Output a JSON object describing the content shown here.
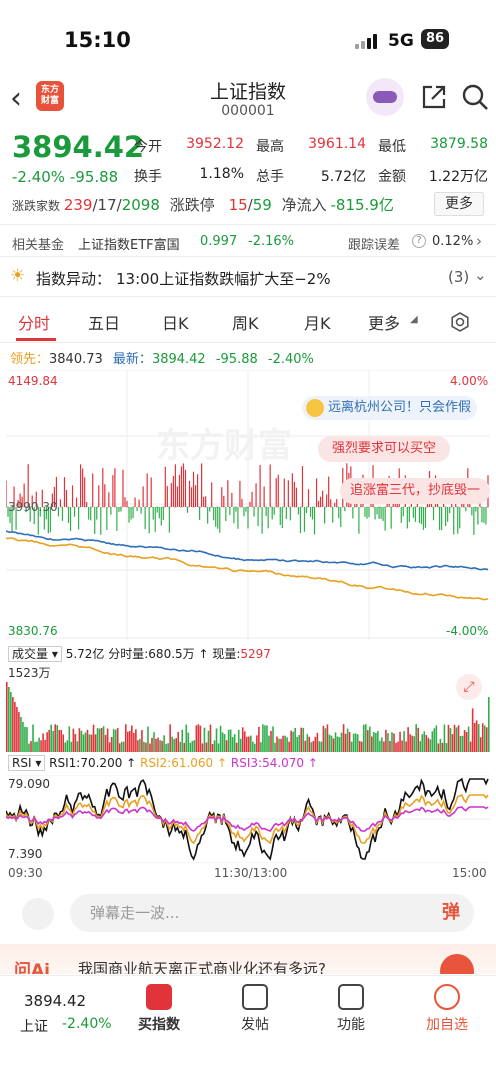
{
  "status": {
    "time": "15:10",
    "network": "5G",
    "battery": "86"
  },
  "header": {
    "logo": "东方\n财富",
    "title": "上证指数",
    "code": "000001",
    "icons": [
      "back-icon",
      "robot-avatar-icon",
      "share-icon",
      "search-icon"
    ]
  },
  "quote": {
    "price": "3894.42",
    "change_pct": "-2.40%",
    "change": "-95.88",
    "open_label": "今开",
    "open": "3952.12",
    "high_label": "最高",
    "high": "3961.14",
    "low_label": "最低",
    "low": "3879.58",
    "turnover_label": "换手",
    "turnover": "1.18%",
    "hands_label": "总手",
    "hands": "5.72亿",
    "amount_label": "金额",
    "amount": "1.22万亿",
    "updown_label": "涨跌家数",
    "up": "239",
    "flat": "17",
    "down": "2098",
    "limit_label": "涨跌停",
    "limit_up": "15",
    "limit_down": "59",
    "inflow_label": "净流入",
    "inflow": "-815.9亿",
    "more": "更多"
  },
  "fund": {
    "label": "相关基金",
    "name": "上证指数ETF富国",
    "value": "0.997",
    "pct": "-2.16%",
    "error_label": "跟踪误差",
    "error": "0.12%"
  },
  "alert": {
    "label": "指数异动：",
    "text": "13:00上证指数跌幅扩大至−2%",
    "count": "(3)"
  },
  "tabs": [
    "分时",
    "五日",
    "日K",
    "周K",
    "月K",
    "更多"
  ],
  "lead": {
    "label": "领先：",
    "lead_value": "3840.73",
    "latest_label": "最新：",
    "latest": "3894.42",
    "chg": "-95.88",
    "pct": "-2.40%"
  },
  "chart": {
    "ymax": "4149.84",
    "ymin": "3830.76",
    "pct_max": "4.00%",
    "pct_min": "-4.00%",
    "base": "3990.30",
    "watermark": "东方财富",
    "comments": [
      "远离杭州公司！只会作假",
      "强烈要求可以买空",
      "追涨富三代，抄底毁一"
    ]
  },
  "volume": {
    "label": "成交量",
    "total": "5.72亿",
    "min_label": "分时量:",
    "min": "680.5万",
    "now_label": "现量:",
    "now": "5297",
    "max": "1523万"
  },
  "rsi": {
    "label": "RSI",
    "r1": "RSI1:70.200",
    "r2": "RSI2:61.060",
    "r3": "RSI3:54.070",
    "max": "79.090",
    "min": "7.390"
  },
  "axis": {
    "start": "09:30",
    "mid": "11:30/13:00",
    "end": "15:00"
  },
  "danmu": {
    "placeholder": "弹幕走一波...",
    "btn": "弹"
  },
  "promo": {
    "text": "我国商业航天离正式商业化还有多远?"
  },
  "bottom": {
    "price": "3894.42",
    "name": "上证",
    "pct": "-2.40%",
    "items": [
      "买指数",
      "发帖",
      "功能",
      "加自选"
    ]
  },
  "colors": {
    "up": "#e0333a",
    "down": "#1a9a3a",
    "line_price": "#2e6fb5",
    "line_lead": "#e8a020"
  }
}
